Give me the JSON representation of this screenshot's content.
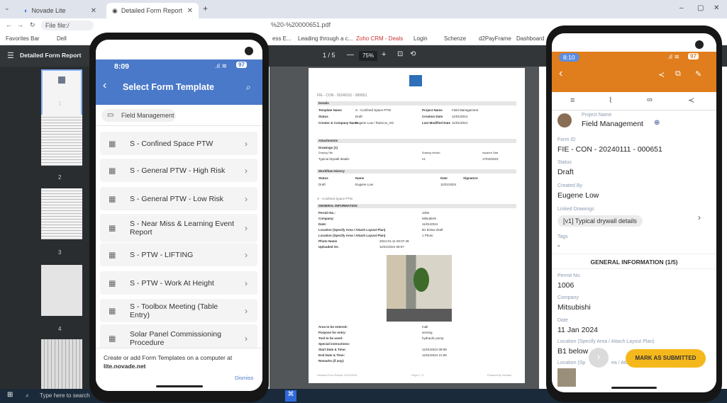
{
  "browser": {
    "tabs": [
      {
        "label": "Novade Lite"
      },
      {
        "label": "Detailed Form Report"
      }
    ],
    "new_tab": "+",
    "window_controls": {
      "minimize": "–",
      "maximize": "▢",
      "close": "✕"
    },
    "address": "File  file:/",
    "address_tail": "%20-%20000651.pdf",
    "bookmarks": [
      "Favorites Bar",
      "Dell",
      "ess E...",
      "Leading through a c...",
      "Zoho CRM - Deals",
      "Login",
      "Schenze",
      "d2PayFrame",
      "Dashboard"
    ]
  },
  "pdf_viewer": {
    "title": "Detailed Form Report",
    "page_indicator": "1 / 5",
    "zoom": "75%",
    "thumb_numbers": [
      "1",
      "2",
      "3",
      "4"
    ],
    "page": {
      "doc_id": "FIE - CON - 20240111 - 000651",
      "details_header": "Details",
      "details": [
        [
          "Template Name",
          "S - Confined Space PTW",
          "Project Name",
          "Field Management"
        ],
        [
          "Status",
          "Draft",
          "Creation Date",
          "11/01/2024"
        ],
        [
          "Creator & Company Name",
          "Eugene Low / Raincoo_SG",
          "Last Modified Date",
          "11/01/2024"
        ]
      ],
      "attachments_header": "Attachments",
      "drawings_label": "Drawings (1)",
      "drawings_cols": [
        "Drawing Title",
        "Drawing Version",
        "Issuance Date"
      ],
      "drawings_row": [
        "Typical drywall details",
        "v1",
        "17/04/2023"
      ],
      "workflow_header": "Workflow History",
      "workflow_cols": [
        "Status",
        "Name",
        "Date",
        "Signature"
      ],
      "workflow_row": [
        "Draft",
        "Eugene Low",
        "11/01/2024"
      ],
      "section_title": "S - Confined Space PTW",
      "general_header": "GENERAL INFORMATION",
      "general": [
        [
          "Permit No.:",
          "1006"
        ],
        [
          "Company:",
          "Mitsubishi"
        ],
        [
          "Date:",
          "11/01/2024"
        ],
        [
          "Location (Specify Area / Attach Layout Plan)",
          "B1 below shaft"
        ],
        [
          "Location (Specify Area / Attach Layout Plan)",
          "1 Photo"
        ],
        [
          "Photo Name",
          "2024-01-11 00:07:49"
        ],
        [
          "Uploaded On",
          "11/01/2024 08:07"
        ]
      ],
      "entry": [
        [
          "Area to be entered:",
          "mall"
        ],
        [
          "Purpose for entry:",
          "serving"
        ],
        [
          "Tool to be used:",
          "hydraulic pump"
        ],
        [
          "Special instructions:",
          ""
        ],
        [
          "Start Date & Time:",
          "11/01/2024 08:08"
        ],
        [
          "End Date & Time:",
          "11/01/2024 21:08"
        ],
        [
          "Remarks (if any):",
          ""
        ]
      ],
      "footer_left": "Detailed Form Report 11/01/2024",
      "footer_mid": "Page 1 / 5",
      "footer_right": "Powered by Novade"
    }
  },
  "phone1": {
    "time": "8:09",
    "battery": "97",
    "title": "Select Form Template",
    "chip": "Field Management",
    "templates": [
      "S - Confined Space PTW",
      "S - General PTW - High Risk",
      "S - General PTW - Low Risk",
      "S - Near Miss & Learning Event Report",
      "S - PTW - LIFTING",
      "S - PTW - Work At Height",
      "S - Toolbox Meeting (Table Entry)",
      "Solar Panel Commissioning Procedure"
    ],
    "footer_text": "Create or add Form Templates on a computer at",
    "footer_link": "lite.novade.net",
    "dismiss": "Dismiss"
  },
  "phone2": {
    "time": "8:10",
    "battery": "97",
    "project_label": "Project Name",
    "project_value": "Field Management",
    "form_id_label": "Form ID",
    "form_id_value": "FIE - CON - 20240111 - 000651",
    "status_label": "Status",
    "status_value": "Draft",
    "created_by_label": "Created By",
    "created_by_value": "Eugene Low",
    "linked_label": "Linked Drawings",
    "linked_value": "[v1] Typical drywall details",
    "tags_label": "Tags",
    "tags_value": "-",
    "section_title": "GENERAL INFORMATION (1/5)",
    "permit_label": "Permit No.",
    "permit_value": "1006",
    "company_label": "Company",
    "company_value": "Mitsubishi",
    "date_label": "Date",
    "date_value": "11 Jan 2024",
    "location_label": "Location (Specify Area / Attach Layout Plan)",
    "location_value": "B1 below",
    "location2_label": "Location (Sp",
    "location2_tail": "ea / Atta",
    "submit_button": "MARK AS SUBMITTED"
  },
  "taskbar": {
    "search": "Type here to search"
  },
  "colors": {
    "phone1_header": "#4a79c9",
    "phone2_header": "#e07d1c",
    "submit_button": "#f5b81c"
  }
}
